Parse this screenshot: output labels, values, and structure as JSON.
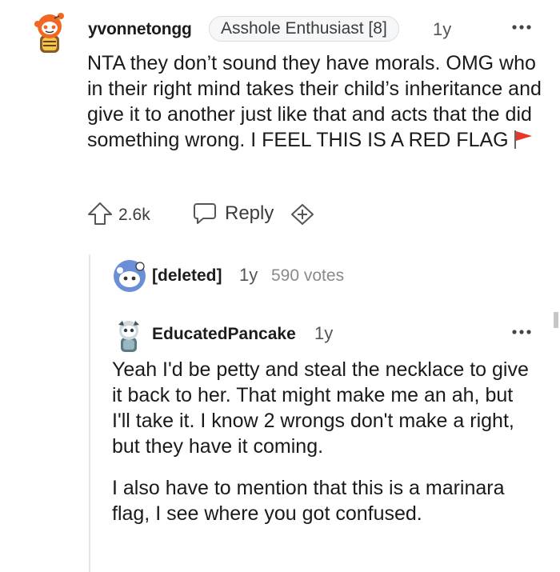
{
  "comment": {
    "username": "yvonnetongg",
    "flair": "Asshole Enthusiast [8]",
    "time": "1y",
    "body": "NTA they don’t sound they have morals. OMG who in their right mind takes their child’s inheritance and give it to another just like that and acts that the did something wrong. I FEEL THIS IS A RED FLAG",
    "score": "2.6k",
    "reply_label": "Reply",
    "icons": [
      "snoo-avatar-icon",
      "more-options-icon",
      "red-flag-icon",
      "upvote-icon",
      "reply-icon",
      "award-icon"
    ]
  },
  "deleted_reply": {
    "username": "[deleted]",
    "time": "1y",
    "votes": "590 votes"
  },
  "nested_reply": {
    "username": "EducatedPancake",
    "time": "1y",
    "paragraphs": [
      "Yeah I'd be petty and steal the necklace to give it back to her. That might make me an ah, but I'll take it. I know 2 wrongs don't make a right, but they have it coming.",
      "I also have to mention that this is a marinara flag, I see where you got confused."
    ]
  },
  "colors": {
    "text": "#1a1a1b",
    "meta": "#555555",
    "flag_red": "#e8362b",
    "avatar_orange": "#f26722"
  }
}
